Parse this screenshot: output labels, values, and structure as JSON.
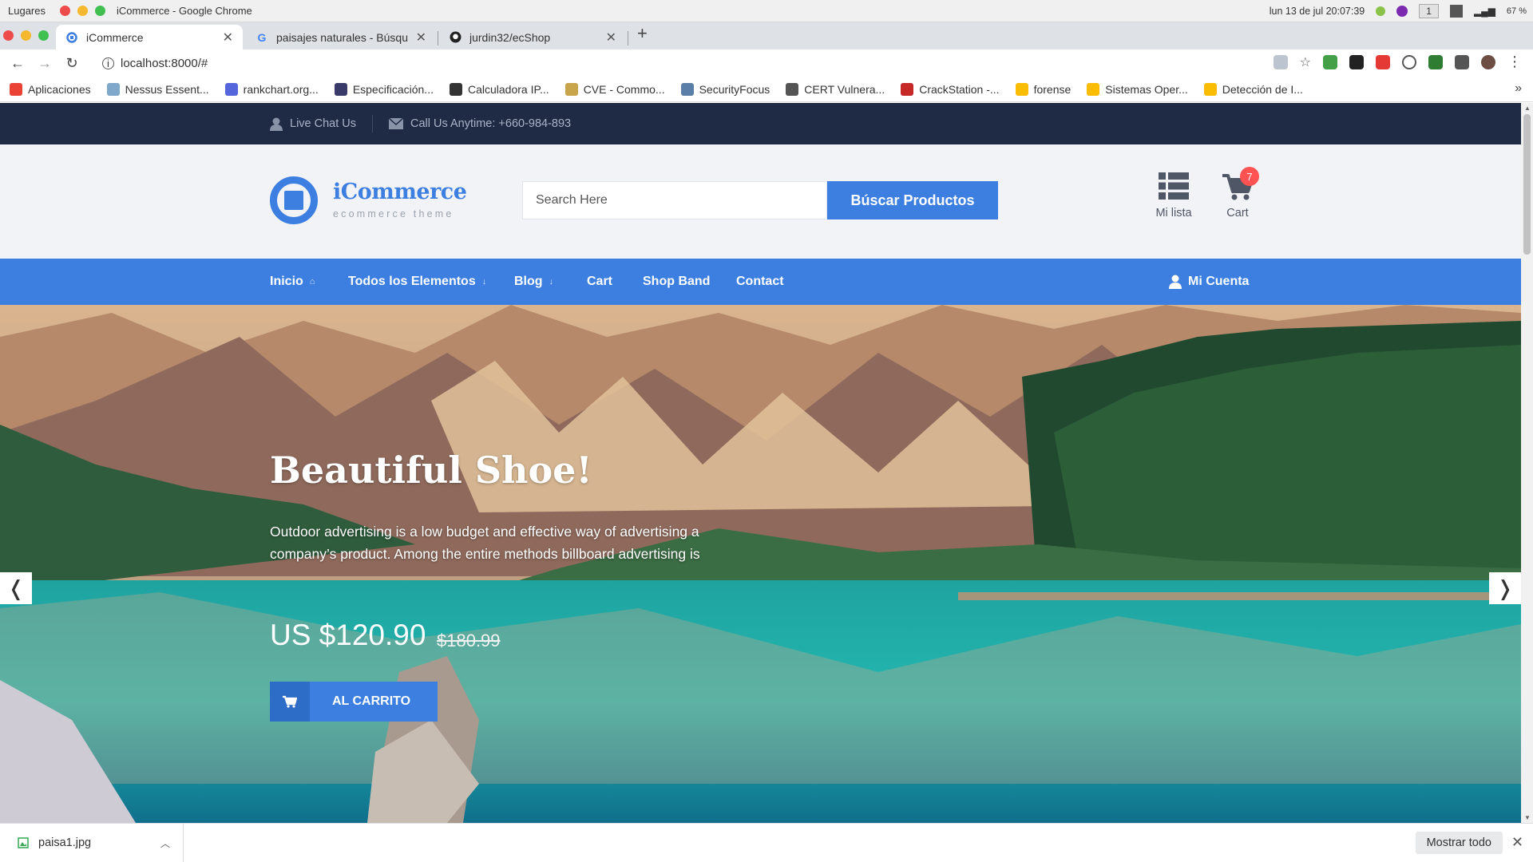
{
  "os": {
    "places": "Lugares",
    "window_title": "iCommerce - Google Chrome",
    "datetime": "lun 13 de jul  20:07:39",
    "workspace": "1",
    "battery": "67 %"
  },
  "browser": {
    "tabs": [
      {
        "label": "iCommerce",
        "active": true
      },
      {
        "label": "paisajes naturales - Búsqu",
        "active": false
      },
      {
        "label": "jurdin32/ecShop",
        "active": false
      }
    ],
    "url": "localhost:8000/#",
    "bookmarks": [
      {
        "label": "Aplicaciones",
        "color": "#ea4335"
      },
      {
        "label": "Nessus Essent...",
        "color": "#7fa7c9"
      },
      {
        "label": "rankchart.org...",
        "color": "#5566dd"
      },
      {
        "label": "Especificación...",
        "color": "#3a3a6a"
      },
      {
        "label": "Calculadora IP...",
        "color": "#333333"
      },
      {
        "label": "CVE - Commo...",
        "color": "#c8a44a"
      },
      {
        "label": "SecurityFocus",
        "color": "#5b7ea8"
      },
      {
        "label": "CERT Vulnera...",
        "color": "#555555"
      },
      {
        "label": "CrackStation -...",
        "color": "#c62828"
      },
      {
        "label": "forense",
        "color": "#fbbc04"
      },
      {
        "label": "Sistemas Oper...",
        "color": "#fbbc04"
      },
      {
        "label": "Detección de I...",
        "color": "#fbbc04"
      }
    ]
  },
  "site": {
    "topbar": {
      "live_chat": "Live Chat Us",
      "call": "Call Us Anytime: +660-984-893"
    },
    "logo": {
      "name": "iCommerce",
      "tagline": "ecommerce theme"
    },
    "search": {
      "placeholder": "Search Here",
      "button": "Búscar Productos"
    },
    "header_icons": {
      "wishlist": "Mi lista",
      "cart": "Cart",
      "cart_count": "7"
    },
    "nav": {
      "items": [
        "Inicio",
        "Todos los Elementos",
        "Blog",
        "Cart",
        "Shop Band",
        "Contact"
      ],
      "account": "Mi Cuenta"
    },
    "hero": {
      "title": "Beautiful Shoe!",
      "text": "Outdoor advertising is a low budget and effective way of advertising a company’s product. Among the entire methods billboard advertising is",
      "price": "US $120.90",
      "old_price": "$180.99",
      "button": "AL CARRITO",
      "prev": "❬",
      "next": "❭"
    }
  },
  "downloads": {
    "file": "paisa1.jpg",
    "show_all": "Mostrar todo"
  },
  "colors": {
    "accent": "#3c7fe0",
    "topbar": "#1f2a44",
    "badge": "#ff5252"
  }
}
